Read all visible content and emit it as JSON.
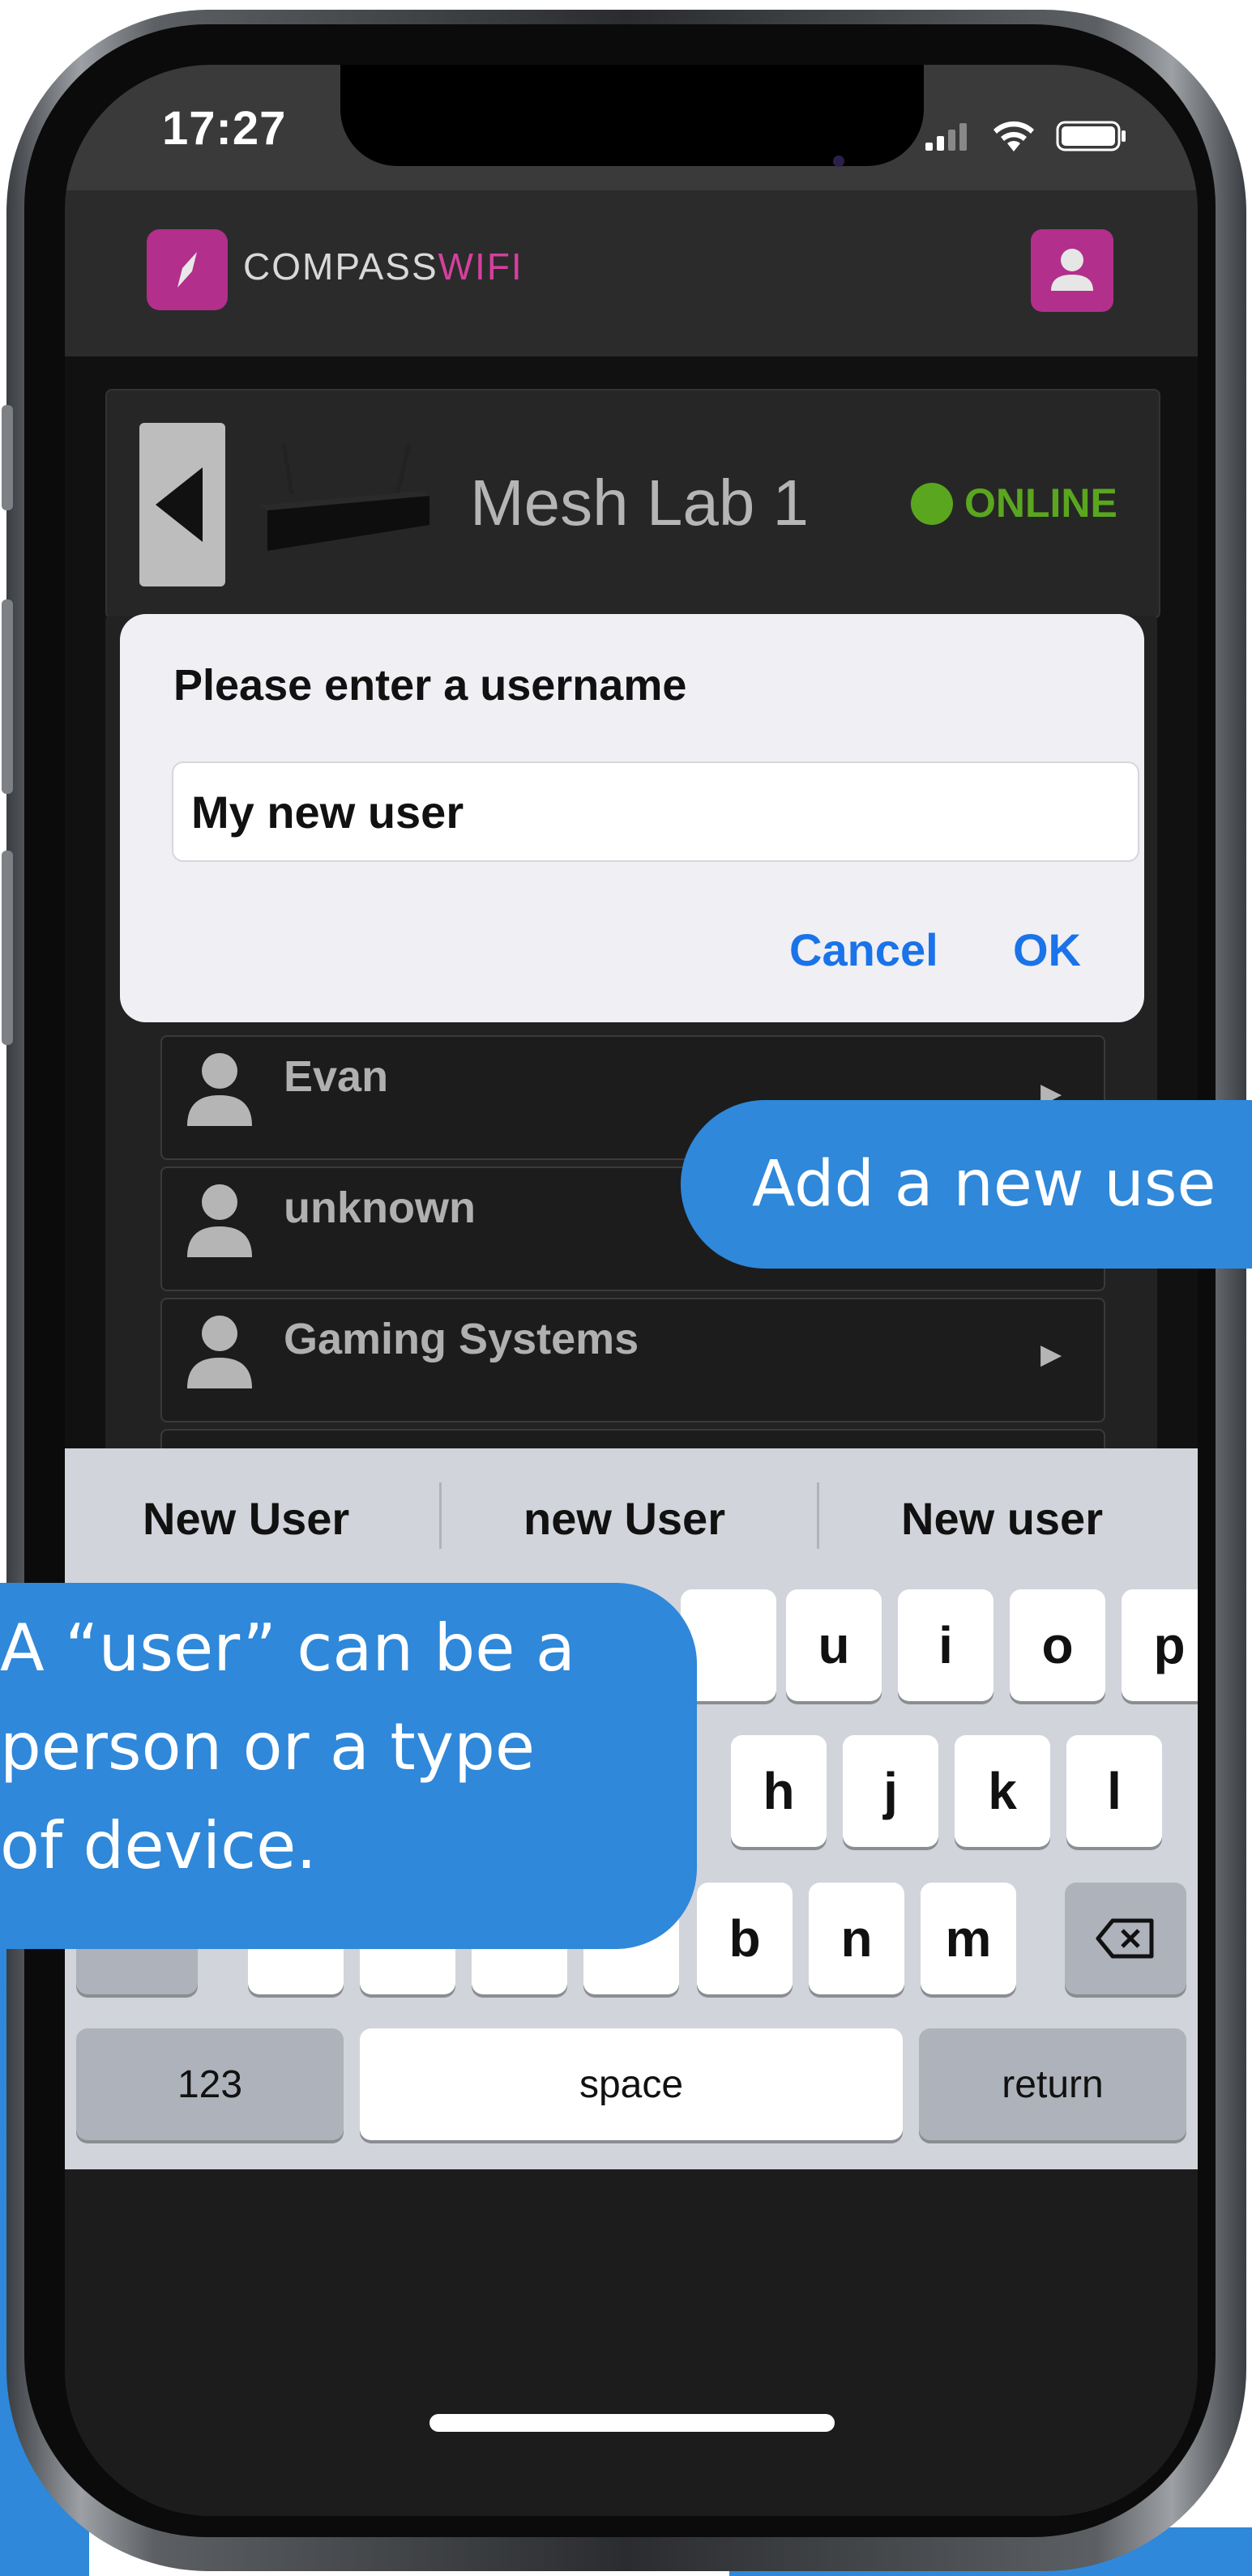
{
  "status_bar": {
    "time": "17:27",
    "icons": [
      "signal-icon",
      "wifi-icon",
      "battery-icon"
    ]
  },
  "app_header": {
    "logo_text_main": "COMPASS",
    "logo_text_accent": "WIFI",
    "logo_icon": "compass-icon",
    "profile_icon": "user-icon",
    "brand_color": "#b22f8c"
  },
  "device": {
    "name": "Mesh Lab 1",
    "status": "ONLINE",
    "status_color": "#5aa61f",
    "back_icon": "triangle-left-icon"
  },
  "users": [
    {
      "name": "Evan",
      "icon": "person-icon"
    },
    {
      "name": "unknown",
      "icon": "person-icon"
    },
    {
      "name": "Gaming Systems",
      "icon": "person-icon"
    }
  ],
  "dialog": {
    "title": "Please enter a username",
    "input_value": "My new user",
    "cancel_label": "Cancel",
    "ok_label": "OK"
  },
  "keyboard": {
    "suggestions": [
      "New User",
      "new User",
      "New user"
    ],
    "row1_visible": [
      "u",
      "i",
      "o",
      "p"
    ],
    "row2_visible": [
      "h",
      "j",
      "k",
      "l"
    ],
    "row3_visible": [
      "b",
      "n",
      "m"
    ],
    "numbers_label": "123",
    "space_label": "space",
    "return_label": "return",
    "backspace_icon": "backspace-icon"
  },
  "callouts": {
    "add_user": "Add a new use",
    "user_explainer_lines": [
      "A “user” can be a",
      "person or a type",
      "of device."
    ],
    "color": "#2f88d9"
  }
}
